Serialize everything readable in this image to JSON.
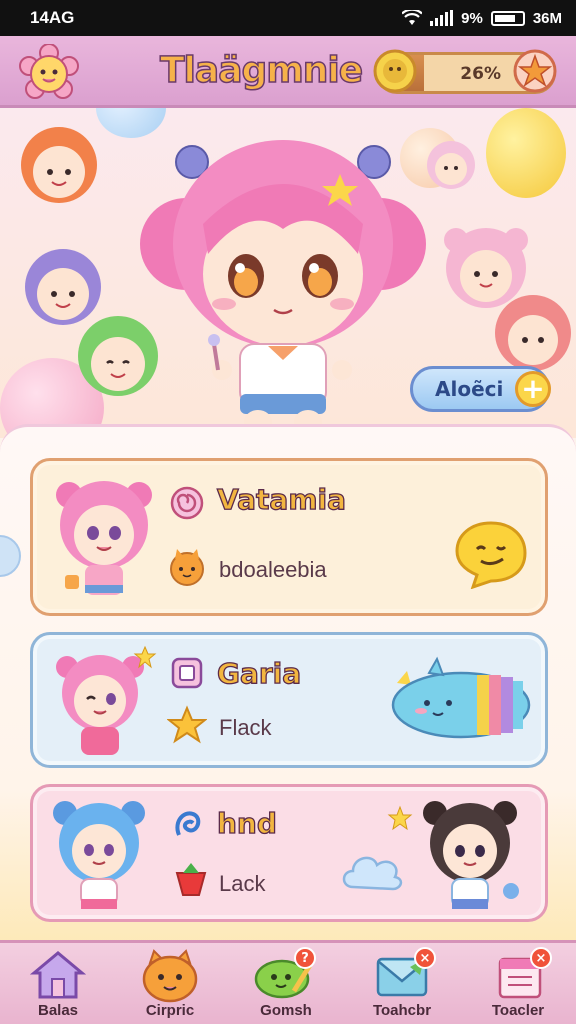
{
  "status_bar": {
    "time": "14AG",
    "battery_text": "9%",
    "signal_text": "36M"
  },
  "header": {
    "title": "Tlaägmnie",
    "progress_text": "26%",
    "progress_fraction": 0.26
  },
  "scene": {
    "about_label": "Aloẽci",
    "about_plus": "+"
  },
  "list": {
    "items": [
      {
        "title": "Vatamia",
        "subtitle": "bdoaleebia"
      },
      {
        "title": "Garia",
        "subtitle": "Flack"
      },
      {
        "title": "hnd",
        "subtitle": "Lack"
      }
    ]
  },
  "bottom_nav": {
    "items": [
      {
        "label": "Balas",
        "icon": "home-icon"
      },
      {
        "label": "Cirpric",
        "icon": "cat-face-icon"
      },
      {
        "label": "Gomsh",
        "icon": "cucumber-icon"
      },
      {
        "label": "Toahcbr",
        "icon": "letter-icon"
      },
      {
        "label": "Toacler",
        "icon": "calendar-icon"
      }
    ]
  },
  "colors": {
    "header": "#e9b6dc",
    "title": "#f2b640",
    "accent_blue": "#9cc9f2",
    "badge": "#f0533a"
  }
}
